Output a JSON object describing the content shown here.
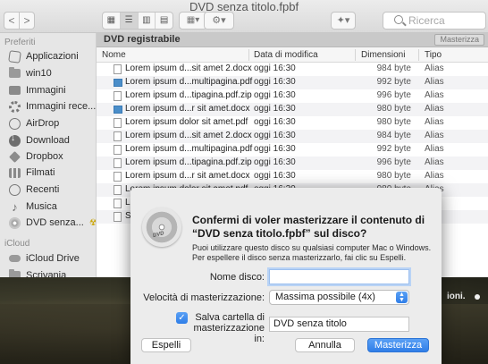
{
  "window": {
    "title": "DVD senza titolo.fpbf"
  },
  "toolbar": {
    "back_glyph": "<",
    "forward_glyph": ">",
    "view_modes": [
      "icon-view",
      "list-view",
      "column-view",
      "gallery-view"
    ],
    "search_placeholder": "Ricerca"
  },
  "sidebar": {
    "favorites_header": "Preferiti",
    "favorites": [
      {
        "label": "Applicazioni",
        "icon": "applications-icon"
      },
      {
        "label": "win10",
        "icon": "folder-icon"
      },
      {
        "label": "Immagini",
        "icon": "pictures-icon"
      },
      {
        "label": "Immagini rece...",
        "icon": "recent-pictures-icon"
      },
      {
        "label": "AirDrop",
        "icon": "airdrop-icon"
      },
      {
        "label": "Download",
        "icon": "download-icon"
      },
      {
        "label": "Dropbox",
        "icon": "dropbox-icon"
      },
      {
        "label": "Filmati",
        "icon": "movies-icon"
      },
      {
        "label": "Recenti",
        "icon": "recents-icon"
      },
      {
        "label": "Musica",
        "icon": "music-icon"
      },
      {
        "label": "DVD senza...",
        "icon": "disc-icon"
      }
    ],
    "icloud_header": "iCloud",
    "icloud": [
      {
        "label": "iCloud Drive",
        "icon": "cloud-icon"
      },
      {
        "label": "Scrivania",
        "icon": "desktop-icon"
      }
    ]
  },
  "content": {
    "pathbar_label": "DVD registrabile",
    "burn_button": "Masterizza",
    "columns": {
      "name": "Nome",
      "date": "Data di modifica",
      "size": "Dimensioni",
      "kind": "Tipo"
    },
    "files": [
      {
        "name": "Lorem ipsum d...sit amet 2.docx",
        "date": "oggi 16:30",
        "size": "984 byte",
        "kind": "Alias",
        "folder": false
      },
      {
        "name": "Lorem ipsum d...multipagina.pdf",
        "date": "oggi 16:30",
        "size": "992 byte",
        "kind": "Alias",
        "folder": true
      },
      {
        "name": "Lorem ipsum d...tipagina.pdf.zip",
        "date": "oggi 16:30",
        "size": "996 byte",
        "kind": "Alias",
        "folder": false
      },
      {
        "name": "Lorem ipsum d...r sit amet.docx",
        "date": "oggi 16:30",
        "size": "980 byte",
        "kind": "Alias",
        "folder": true
      },
      {
        "name": "Lorem ipsum dolor sit amet.pdf",
        "date": "oggi 16:30",
        "size": "980 byte",
        "kind": "Alias",
        "folder": false
      },
      {
        "name": "Lorem ipsum d...sit amet 2.docx",
        "date": "oggi 16:30",
        "size": "984 byte",
        "kind": "Alias",
        "folder": false
      },
      {
        "name": "Lorem ipsum d...multipagina.pdf",
        "date": "oggi 16:30",
        "size": "992 byte",
        "kind": "Alias",
        "folder": false
      },
      {
        "name": "Lorem ipsum d...tipagina.pdf.zip",
        "date": "oggi 16:30",
        "size": "996 byte",
        "kind": "Alias",
        "folder": false
      },
      {
        "name": "Lorem ipsum d...r sit amet.docx",
        "date": "oggi 16:30",
        "size": "980 byte",
        "kind": "Alias",
        "folder": false
      },
      {
        "name": "Lorem ipsum dolor sit amet.pdf",
        "date": "oggi 16:30",
        "size": "980 byte",
        "kind": "Alias",
        "folder": false
      },
      {
        "name": "L",
        "date": "",
        "size": "",
        "kind": "",
        "folder": false
      },
      {
        "name": "S",
        "date": "",
        "size": "",
        "kind": "",
        "folder": false
      }
    ]
  },
  "dialog": {
    "disc_label": "DVD",
    "title": "Confermi di voler masterizzare il contenuto di “DVD senza titolo.fpbf” sul disco?",
    "body": "Puoi utilizzare questo disco su qualsiasi computer Mac o Windows. Per espellere il disco senza masterizzarlo, fai clic su Espelli.",
    "disc_name_label": "Nome disco:",
    "disc_name_value": "",
    "speed_label": "Velocità di masterizzazione:",
    "speed_value": "Massima possibile (4x)",
    "save_folder_checked": true,
    "save_folder_label": "Salva cartella di masterizzazione in:",
    "save_folder_value": "DVD senza titolo",
    "buttons": {
      "expand": "Espelli",
      "cancel": "Annulla",
      "burn": "Masterizza"
    }
  },
  "desktop": {
    "visible_text": "ioni."
  },
  "colors": {
    "accent": "#2f7ee8",
    "folder": "#4b8ec9",
    "eject": "#c9a400"
  }
}
